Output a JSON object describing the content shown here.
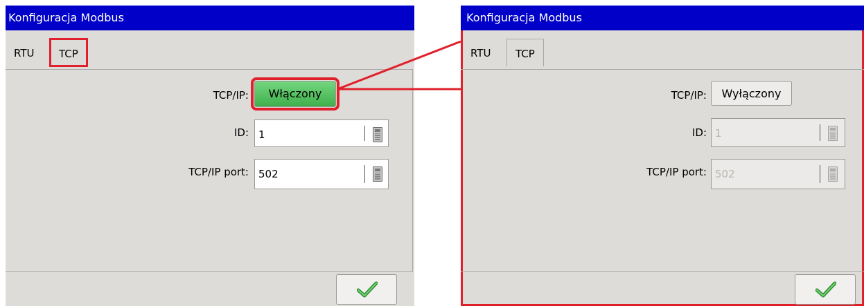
{
  "window_title": "Konfiguracja Modbus",
  "tabs": [
    "RTU",
    "TCP"
  ],
  "left": {
    "tcpip_label": "TCP/IP:",
    "tcpip_state": "Włączony",
    "id_label": "ID:",
    "id_value": "1",
    "port_label": "TCP/IP port:",
    "port_value": "502"
  },
  "right": {
    "tcpip_label": "TCP/IP:",
    "tcpip_state": "Wyłączony",
    "id_label": "ID:",
    "id_value": "1",
    "port_label": "TCP/IP port:",
    "port_value": "502"
  },
  "colors": {
    "titlebar": "#0000c8",
    "highlight": "#e0202a",
    "enabled_green": "#3eb04b",
    "panel_bg": "#dedcd9"
  },
  "icons": [
    "calculator-icon",
    "checkmark-icon"
  ]
}
